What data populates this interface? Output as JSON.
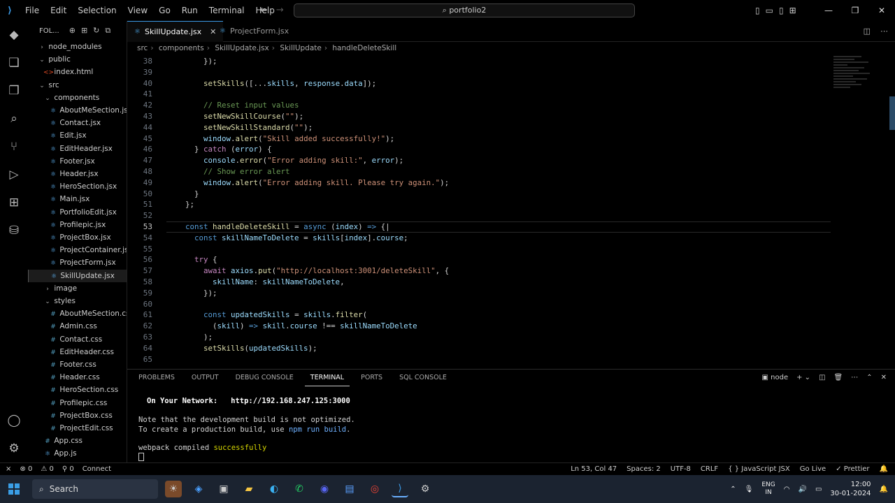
{
  "titlebar": {
    "menu": [
      "File",
      "Edit",
      "Selection",
      "View",
      "Go",
      "Run",
      "Terminal",
      "Help"
    ],
    "search": "portfolio2"
  },
  "sidebar": {
    "title": "FOL...",
    "items": [
      {
        "label": "node_modules",
        "indent": 1,
        "kind": "folder",
        "open": false
      },
      {
        "label": "public",
        "indent": 1,
        "kind": "folder",
        "open": true
      },
      {
        "label": "index.html",
        "indent": 2,
        "kind": "html"
      },
      {
        "label": "src",
        "indent": 1,
        "kind": "folder",
        "open": true
      },
      {
        "label": "components",
        "indent": 2,
        "kind": "folder",
        "open": true
      },
      {
        "label": "AboutMeSection.jsx",
        "indent": 3,
        "kind": "jsx"
      },
      {
        "label": "Contact.jsx",
        "indent": 3,
        "kind": "jsx"
      },
      {
        "label": "Edit.jsx",
        "indent": 3,
        "kind": "jsx"
      },
      {
        "label": "EditHeader.jsx",
        "indent": 3,
        "kind": "jsx"
      },
      {
        "label": "Footer.jsx",
        "indent": 3,
        "kind": "jsx"
      },
      {
        "label": "Header.jsx",
        "indent": 3,
        "kind": "jsx"
      },
      {
        "label": "HeroSection.jsx",
        "indent": 3,
        "kind": "jsx"
      },
      {
        "label": "Main.jsx",
        "indent": 3,
        "kind": "jsx"
      },
      {
        "label": "PortfolioEdit.jsx",
        "indent": 3,
        "kind": "jsx"
      },
      {
        "label": "Profilepic.jsx",
        "indent": 3,
        "kind": "jsx"
      },
      {
        "label": "ProjectBox.jsx",
        "indent": 3,
        "kind": "jsx"
      },
      {
        "label": "ProjectContainer.jsx",
        "indent": 3,
        "kind": "jsx"
      },
      {
        "label": "ProjectForm.jsx",
        "indent": 3,
        "kind": "jsx"
      },
      {
        "label": "SkillUpdate.jsx",
        "indent": 3,
        "kind": "jsx",
        "selected": true
      },
      {
        "label": "image",
        "indent": 2,
        "kind": "folder",
        "open": false
      },
      {
        "label": "styles",
        "indent": 2,
        "kind": "folder",
        "open": true
      },
      {
        "label": "AboutMeSection.css",
        "indent": 3,
        "kind": "css"
      },
      {
        "label": "Admin.css",
        "indent": 3,
        "kind": "css"
      },
      {
        "label": "Contact.css",
        "indent": 3,
        "kind": "css"
      },
      {
        "label": "EditHeader.css",
        "indent": 3,
        "kind": "css"
      },
      {
        "label": "Footer.css",
        "indent": 3,
        "kind": "css"
      },
      {
        "label": "Header.css",
        "indent": 3,
        "kind": "css"
      },
      {
        "label": "HeroSection.css",
        "indent": 3,
        "kind": "css"
      },
      {
        "label": "Profilepic.css",
        "indent": 3,
        "kind": "css"
      },
      {
        "label": "ProjectBox.css",
        "indent": 3,
        "kind": "css"
      },
      {
        "label": "ProjectEdit.css",
        "indent": 3,
        "kind": "css"
      },
      {
        "label": "App.css",
        "indent": 2,
        "kind": "css"
      },
      {
        "label": "App.js",
        "indent": 2,
        "kind": "jsx"
      }
    ]
  },
  "tabs": [
    {
      "label": "SkillUpdate.jsx",
      "active": true
    },
    {
      "label": "ProjectForm.jsx",
      "active": false
    }
  ],
  "breadcrumb": [
    "src",
    "components",
    "SkillUpdate.jsx",
    "SkillUpdate",
    "handleDeleteSkill"
  ],
  "editor": {
    "current_line": 53,
    "lines": [
      {
        "n": 38,
        "html": "      <span>});</span>"
      },
      {
        "n": 39,
        "html": ""
      },
      {
        "n": 40,
        "html": "      <span class='fn'>setSkills</span>([...<span class='v'>skills</span>, <span class='v'>response</span>.<span class='v'>data</span>]);"
      },
      {
        "n": 41,
        "html": ""
      },
      {
        "n": 42,
        "html": "      <span class='c'>// Reset input values</span>"
      },
      {
        "n": 43,
        "html": "      <span class='fn'>setNewSkillCourse</span>(<span class='s'>\"\"</span>);"
      },
      {
        "n": 44,
        "html": "      <span class='fn'>setNewSkillStandard</span>(<span class='s'>\"\"</span>);"
      },
      {
        "n": 45,
        "html": "      <span class='v'>window</span>.<span class='fn'>alert</span>(<span class='s'>\"Skill added successfully!\"</span>);"
      },
      {
        "n": 46,
        "html": "    } <span class='p'>catch</span> (<span class='v'>error</span>) {"
      },
      {
        "n": 47,
        "html": "      <span class='v'>console</span>.<span class='fn'>error</span>(<span class='s'>\"Error adding skill:\"</span>, <span class='v'>error</span>);"
      },
      {
        "n": 48,
        "html": "      <span class='c'>// Show error alert</span>"
      },
      {
        "n": 49,
        "html": "      <span class='v'>window</span>.<span class='fn'>alert</span>(<span class='s'>\"Error adding skill. Please try again.\"</span>);"
      },
      {
        "n": 50,
        "html": "    }"
      },
      {
        "n": 51,
        "html": "  };"
      },
      {
        "n": 52,
        "html": ""
      },
      {
        "n": 53,
        "html": "  <span class='k'>const</span> <span class='fn'>handleDeleteSkill</span> = <span class='k'>async</span> (<span class='v'>index</span>) <span class='k'>=&gt;</span> {|"
      },
      {
        "n": 54,
        "html": "    <span class='k'>const</span> <span class='v'>skillNameToDelete</span> = <span class='v'>skills</span>[<span class='v'>index</span>].<span class='v'>course</span>;"
      },
      {
        "n": 55,
        "html": ""
      },
      {
        "n": 56,
        "html": "    <span class='p'>try</span> {"
      },
      {
        "n": 57,
        "html": "      <span class='p'>await</span> <span class='v'>axios</span>.<span class='fn'>put</span>(<span class='s'>\"http://localhost:3001/deleteSkill\"</span>, {"
      },
      {
        "n": 58,
        "html": "        <span class='v'>skillName</span>: <span class='v'>skillNameToDelete</span>,"
      },
      {
        "n": 59,
        "html": "      });"
      },
      {
        "n": 60,
        "html": ""
      },
      {
        "n": 61,
        "html": "      <span class='k'>const</span> <span class='v'>updatedSkills</span> = <span class='v'>skills</span>.<span class='fn'>filter</span>("
      },
      {
        "n": 62,
        "html": "        (<span class='v'>skill</span>) <span class='k'>=&gt;</span> <span class='v'>skill</span>.<span class='v'>course</span> !== <span class='v'>skillNameToDelete</span>"
      },
      {
        "n": 63,
        "html": "      );"
      },
      {
        "n": 64,
        "html": "      <span class='fn'>setSkills</span>(<span class='v'>updatedSkills</span>);"
      },
      {
        "n": 65,
        "html": ""
      }
    ]
  },
  "panel": {
    "tabs": [
      "PROBLEMS",
      "OUTPUT",
      "DEBUG CONSOLE",
      "TERMINAL",
      "PORTS",
      "SQL CONSOLE"
    ],
    "active_tab": "TERMINAL",
    "shell": "node",
    "network_label": "On Your Network:",
    "network_url": "http://192.168.247.125:3000",
    "note1": "Note that the development build is not optimized.",
    "note2_a": "To create a production build, use ",
    "note2_cmd": "npm run build",
    "note2_b": ".",
    "compiled_a": "webpack compiled ",
    "compiled_b": "successfully"
  },
  "statusbar": {
    "remote": "⨯",
    "errors": "⊗ 0",
    "warnings": "⚠ 0",
    "ports": "⚲ 0",
    "connect": "Connect",
    "position": "Ln 53, Col 47",
    "spaces": "Spaces: 2",
    "encoding": "UTF-8",
    "eol": "CRLF",
    "language": "{ } JavaScript JSX",
    "golive": "Go Live",
    "prettier": "✓ Prettier"
  },
  "taskbar": {
    "search": "Search",
    "lang1": "ENG",
    "lang2": "IN",
    "time": "12:00",
    "date": "30-01-2024"
  },
  "colors": {
    "accent": "#3b9ae6",
    "taskbar": "#1b2330"
  }
}
